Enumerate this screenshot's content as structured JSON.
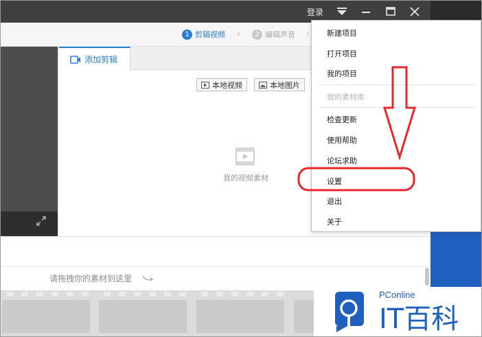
{
  "titlebar": {
    "login_label": "登录"
  },
  "steps": [
    {
      "num": "1",
      "label": "剪辑视频"
    },
    {
      "num": "2",
      "label": "编辑声音"
    }
  ],
  "media": {
    "tab_label": "添加剪辑",
    "add_video_label": "本地视频",
    "add_image_label": "本地图片",
    "empty_text": "我的视频素材"
  },
  "timeline": {
    "hint": "请拖拽你的素材到这里"
  },
  "menu": {
    "items": [
      "新建项目",
      "打开项目",
      "我的项目",
      "我的素材库",
      "检查更新",
      "使用帮助",
      "论坛求助",
      "设置",
      "退出",
      "关于"
    ],
    "disabled": [
      "我的素材库"
    ]
  },
  "watermark": {
    "brand_top": "PConline",
    "brand_main": "IT百科"
  },
  "colors": {
    "accent": "#2b7cd3",
    "titlebar": "#3f3f3f",
    "annotation": "#e8262c",
    "desktop": "#1f5fbf"
  }
}
